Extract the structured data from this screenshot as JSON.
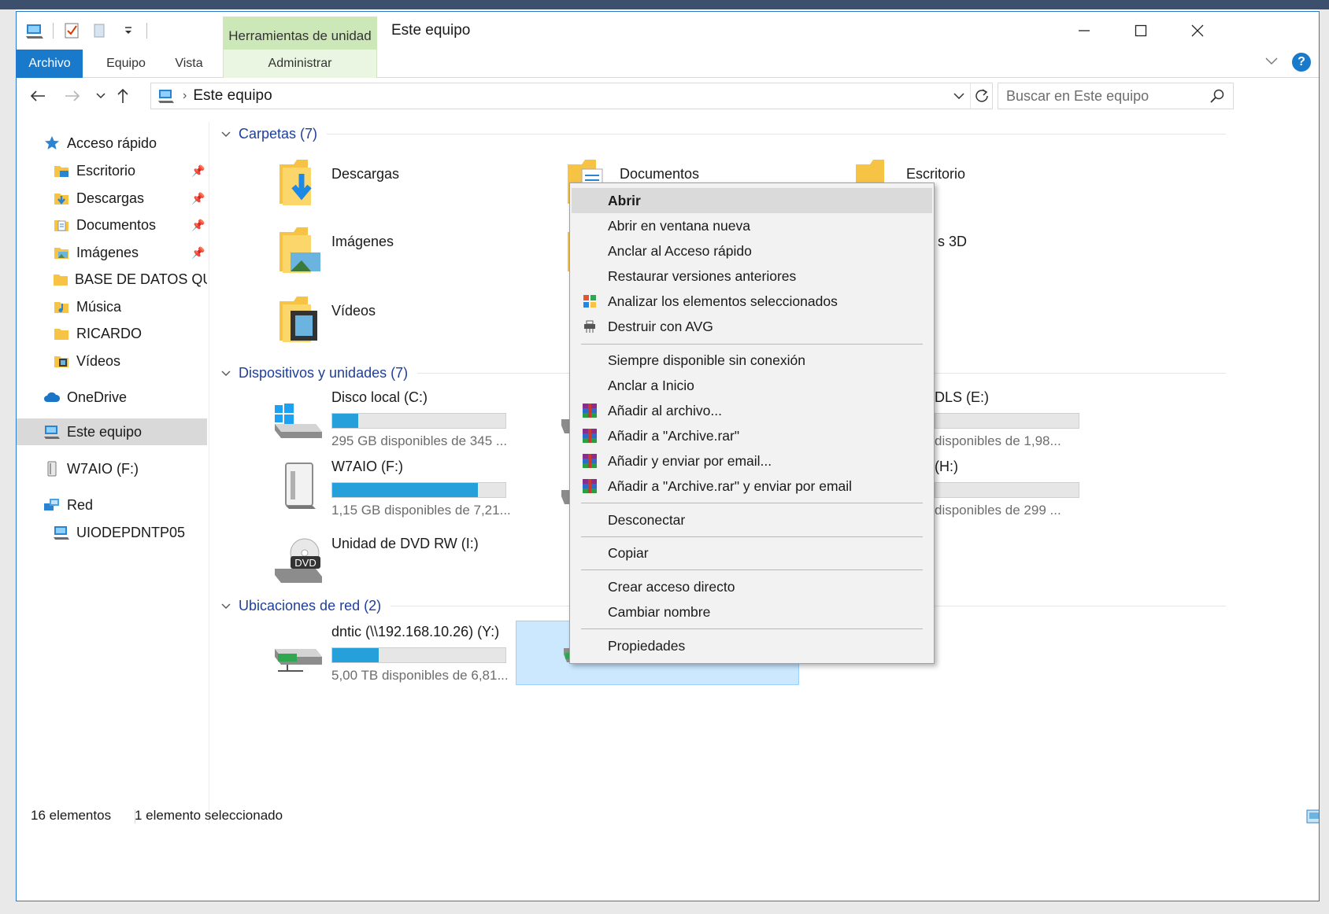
{
  "window": {
    "title": "Este equipo",
    "context_tab_header": "Herramientas de unidad"
  },
  "ribbon": {
    "tabs": [
      "Archivo",
      "Equipo",
      "Vista",
      "Administrar"
    ]
  },
  "navigation": {
    "breadcrumb": "Este equipo",
    "search_placeholder": "Buscar en Este equipo"
  },
  "sidebar": {
    "quick_access": "Acceso rápido",
    "pinned": [
      "Escritorio",
      "Descargas",
      "Documentos",
      "Imágenes"
    ],
    "others": [
      "BASE DE DATOS QU",
      "Música",
      "RICARDO",
      "Vídeos"
    ],
    "onedrive": "OneDrive",
    "this_pc": "Este equipo",
    "usb": "W7AIO (F:)",
    "network": "Red",
    "network_child": "UIODEPDNTP05"
  },
  "groups": {
    "folders": "Carpetas (7)",
    "devices": "Dispositivos y unidades (7)",
    "network": "Ubicaciones de red (2)"
  },
  "folders": {
    "descargas": "Descargas",
    "documentos": "Documentos",
    "escritorio": "Escritorio",
    "imagenes": "Imágenes",
    "objetos3d_partial": "s 3D",
    "videos": "Vídeos"
  },
  "drives": {
    "c": {
      "label": "Disco local (C:)",
      "free": "295 GB disponibles de 345 ...",
      "used_fraction": 0.15
    },
    "f": {
      "label": "W7AIO (F:)",
      "free": "1,15 GB disponibles de 7,21...",
      "used_fraction": 0.84
    },
    "i": {
      "label": "Unidad de DVD RW (I:)",
      "badge": "DVD"
    },
    "e_partial": {
      "label": "DLS (E:)",
      "free": "disponibles de 1,98..."
    },
    "h_partial": {
      "label": "(H:)",
      "free": "disponibles de 299 ..."
    }
  },
  "network_locations": {
    "y": {
      "label": "dntic (\\\\192.168.10.26) (Y:)",
      "free": "5,00 TB disponibles de 6,81...",
      "used_fraction": 0.27
    }
  },
  "context_menu": {
    "items": [
      "Abrir",
      "Abrir en ventana nueva",
      "Anclar al Acceso rápido",
      "Restaurar versiones anteriores",
      "Analizar los elementos seleccionados",
      "Destruir con AVG",
      "Siempre disponible sin conexión",
      "Anclar a Inicio",
      "Añadir al archivo...",
      "Añadir a \"Archive.rar\"",
      "Añadir y enviar por email...",
      "Añadir a \"Archive.rar\" y enviar por email",
      "Desconectar",
      "Copiar",
      "Crear acceso directo",
      "Cambiar nombre",
      "Propiedades"
    ]
  },
  "statusbar": {
    "count": "16 elementos",
    "selection": "1 elemento seleccionado"
  },
  "colors": {
    "accent": "#1979ca",
    "progress": "#26a0da",
    "group_header": "#1e3f9a",
    "selection": "#cce8ff",
    "context_tab": "#cde8b8"
  }
}
